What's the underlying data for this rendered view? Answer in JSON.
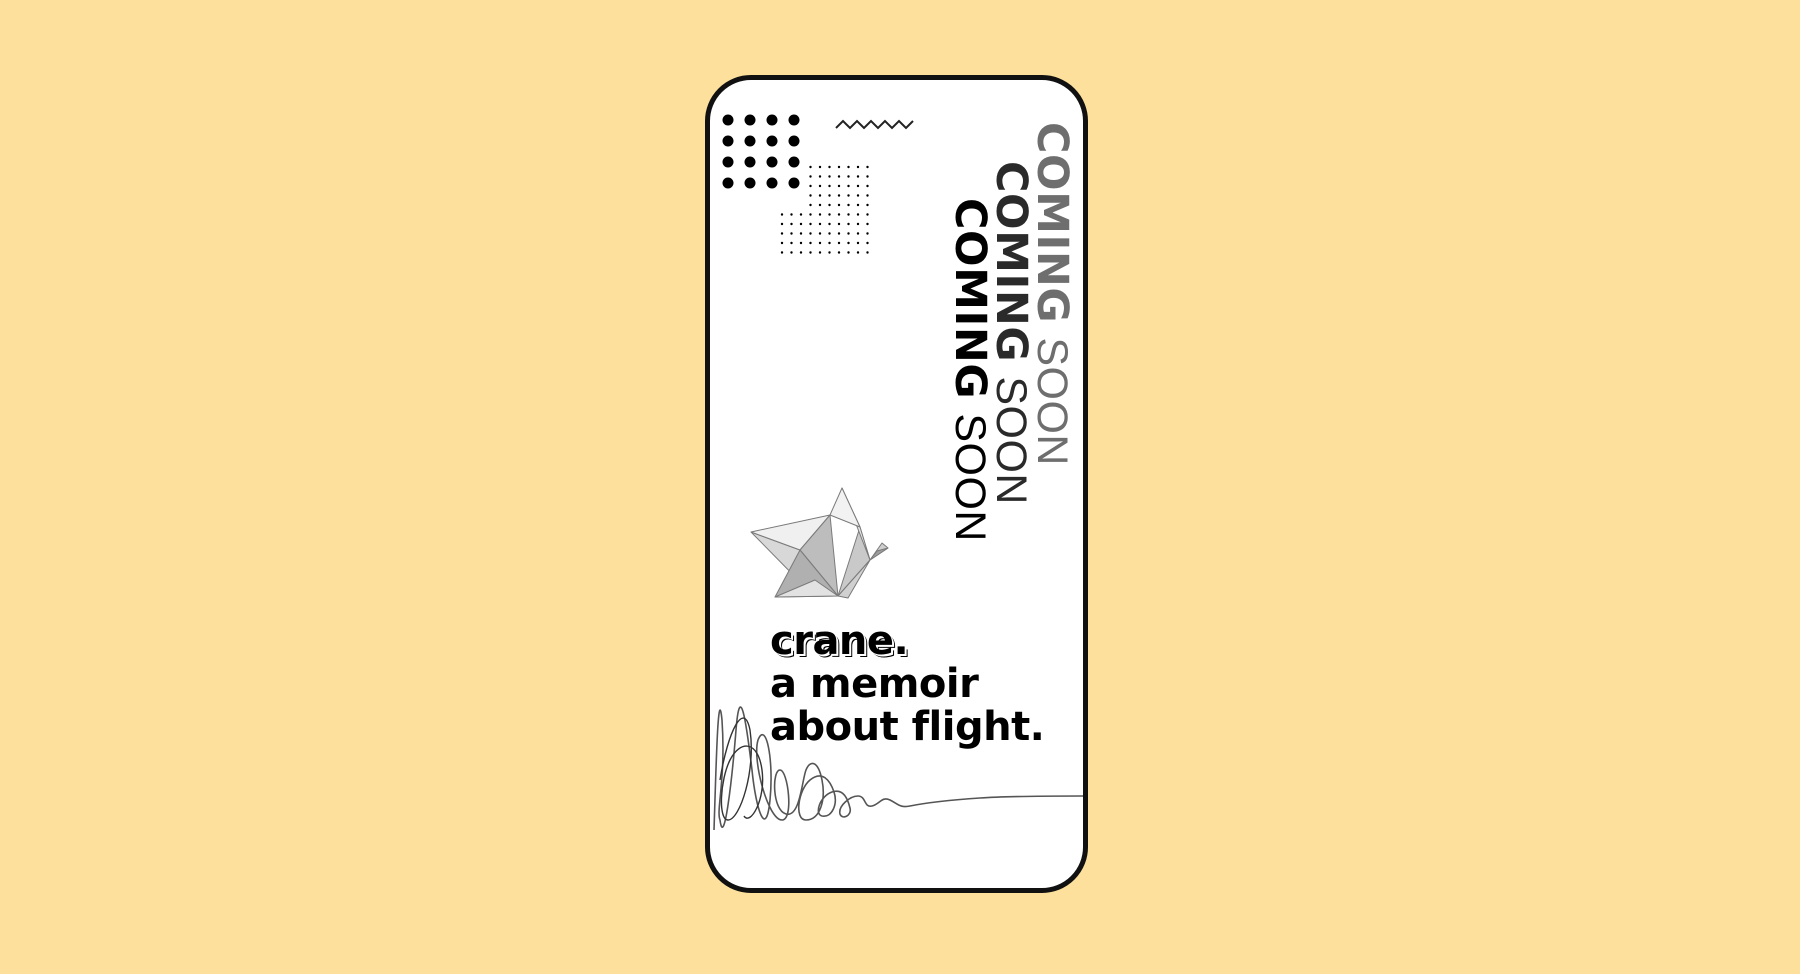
{
  "background": {
    "color": "#fde09b"
  },
  "poster": {
    "coming_soon": [
      {
        "bold": "COMING",
        "light": "SOON"
      },
      {
        "bold": "COMING",
        "light": "SOON"
      },
      {
        "bold": "COMING",
        "light": "SOON"
      }
    ],
    "title_lines": [
      "crane.",
      "a memoir",
      "about flight."
    ],
    "colors": {
      "frame": "#111111",
      "screen": "#ffffff",
      "coming_1": "#6e6e6e",
      "coming_2": "#2a2a2a",
      "coming_3": "#000000"
    },
    "icons": [
      "dot-grid-icon",
      "zigzag-icon",
      "origami-crane-icon",
      "scribble-line-icon"
    ]
  }
}
